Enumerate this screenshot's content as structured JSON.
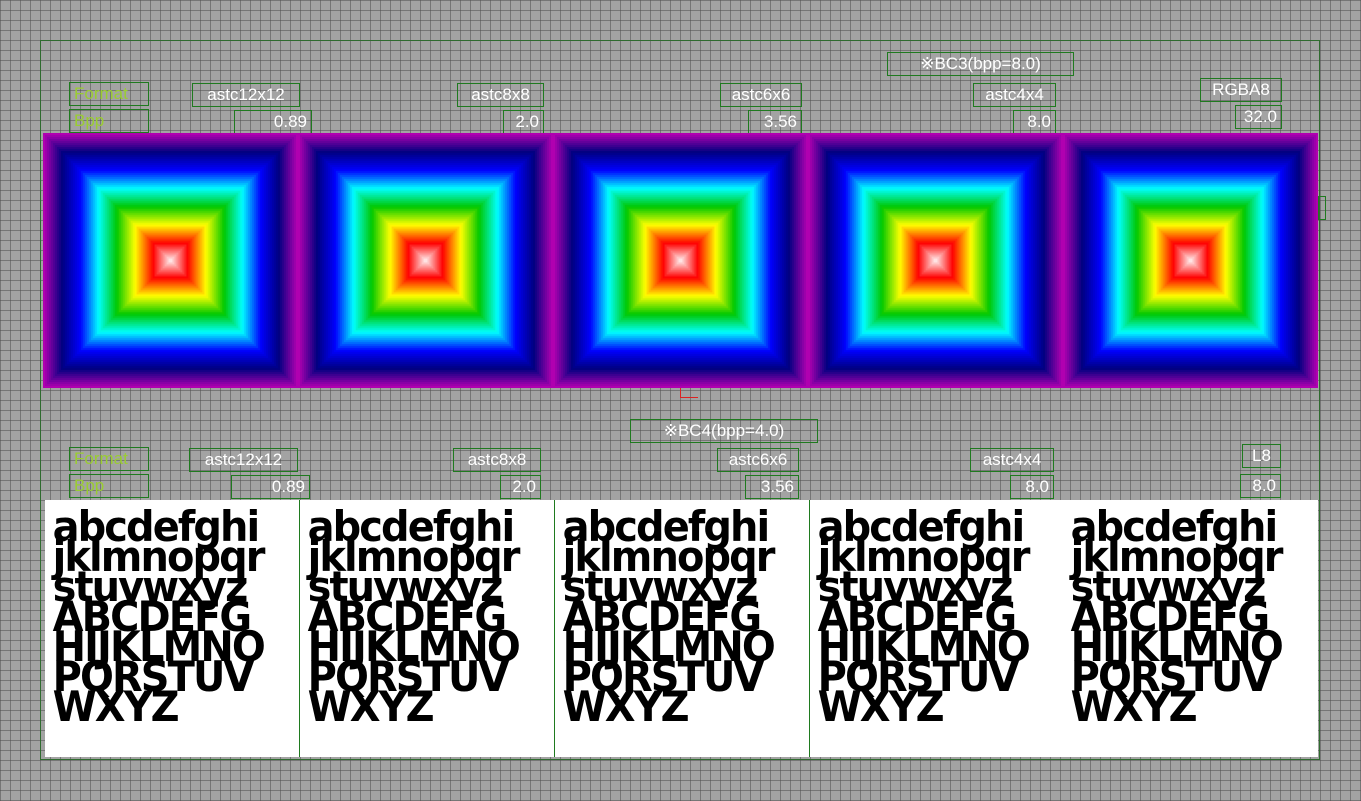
{
  "top": {
    "note": "※BC3(bpp=8.0)",
    "format_label": "Format",
    "bpp_label": "Bpp",
    "formats": [
      "astc12x12",
      "astc8x8",
      "astc6x6",
      "astc4x4",
      "RGBA8"
    ],
    "bpps": [
      "0.89",
      "2.0",
      "3.56",
      "8.0",
      "32.0"
    ]
  },
  "bottom": {
    "note": "※BC4(bpp=4.0)",
    "format_label": "Format",
    "bpp_label": "Bpp",
    "formats": [
      "astc12x12",
      "astc8x8",
      "astc6x6",
      "astc4x4",
      "L8"
    ],
    "bpps": [
      "0.89",
      "2.0",
      "3.56",
      "8.0",
      "8.0"
    ]
  },
  "sample_text": [
    "abcdefghi",
    "jklmnopqr",
    "stuvwxyz",
    "ABCDEFG",
    "HIJKLMNO",
    "PQRSTUV",
    "WXYZ"
  ],
  "colors": {
    "label_border": "#1f7a1f",
    "label_key_text": "#9acd32",
    "label_value_text": "#ffffff",
    "rainbow": [
      "#ffffff",
      "#ff0000",
      "#ffff00",
      "#00c800",
      "#00ffff",
      "#0000ff",
      "#000080",
      "#b000b0"
    ]
  }
}
